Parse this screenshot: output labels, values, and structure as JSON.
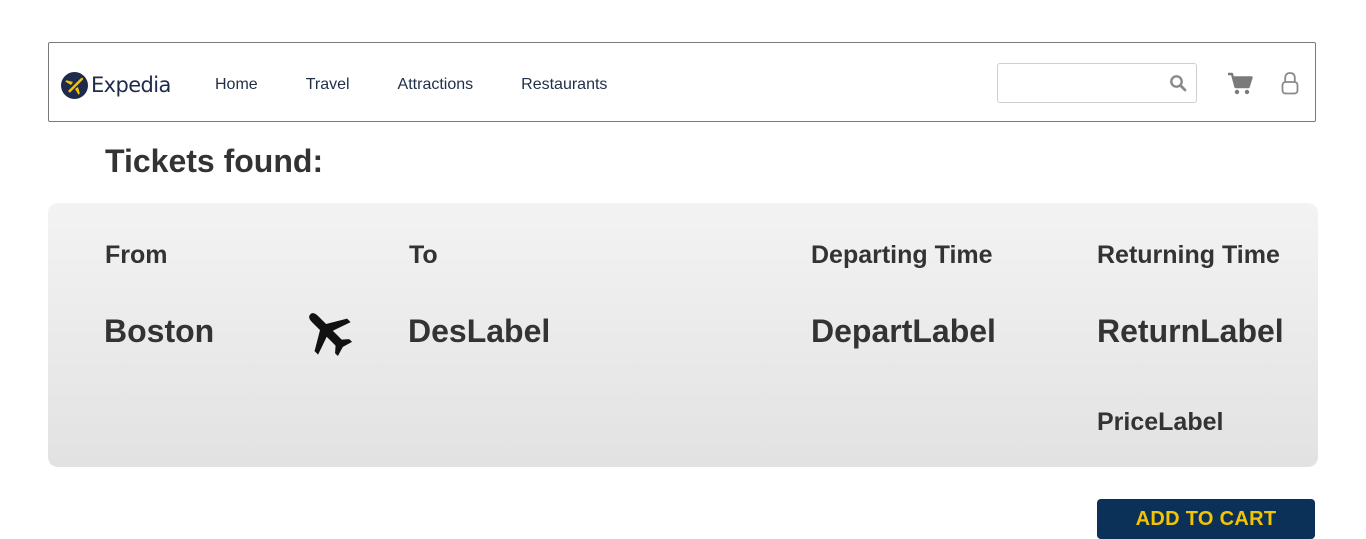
{
  "header": {
    "logo_text": "Expedia",
    "nav": [
      {
        "label": "Home"
      },
      {
        "label": "Travel"
      },
      {
        "label": "Attractions"
      },
      {
        "label": "Restaurants"
      }
    ],
    "search": {
      "placeholder": "",
      "value": ""
    },
    "icons": {
      "logo": "expedia-logo-plane-icon",
      "search": "search-icon",
      "cart": "shopping-cart-icon",
      "account": "user-lock-icon"
    }
  },
  "main": {
    "title": "Tickets found:",
    "ticket": {
      "from_label": "From",
      "from_value": "Boston",
      "to_label": "To",
      "to_value": "DesLabel",
      "depart_label": "Departing Time",
      "depart_value": "DepartLabel",
      "return_label": "Returning Time",
      "return_value": "ReturnLabel",
      "price_value": "PriceLabel",
      "icon": "airplane-icon"
    },
    "add_to_cart_label": "ADD TO CART"
  },
  "colors": {
    "navy": "#0b3158",
    "button_text_yellow": "#f5c400",
    "text_dark": "#333333",
    "card_bg_top": "#f3f3f3",
    "card_bg_bottom": "#e2e2e2"
  }
}
